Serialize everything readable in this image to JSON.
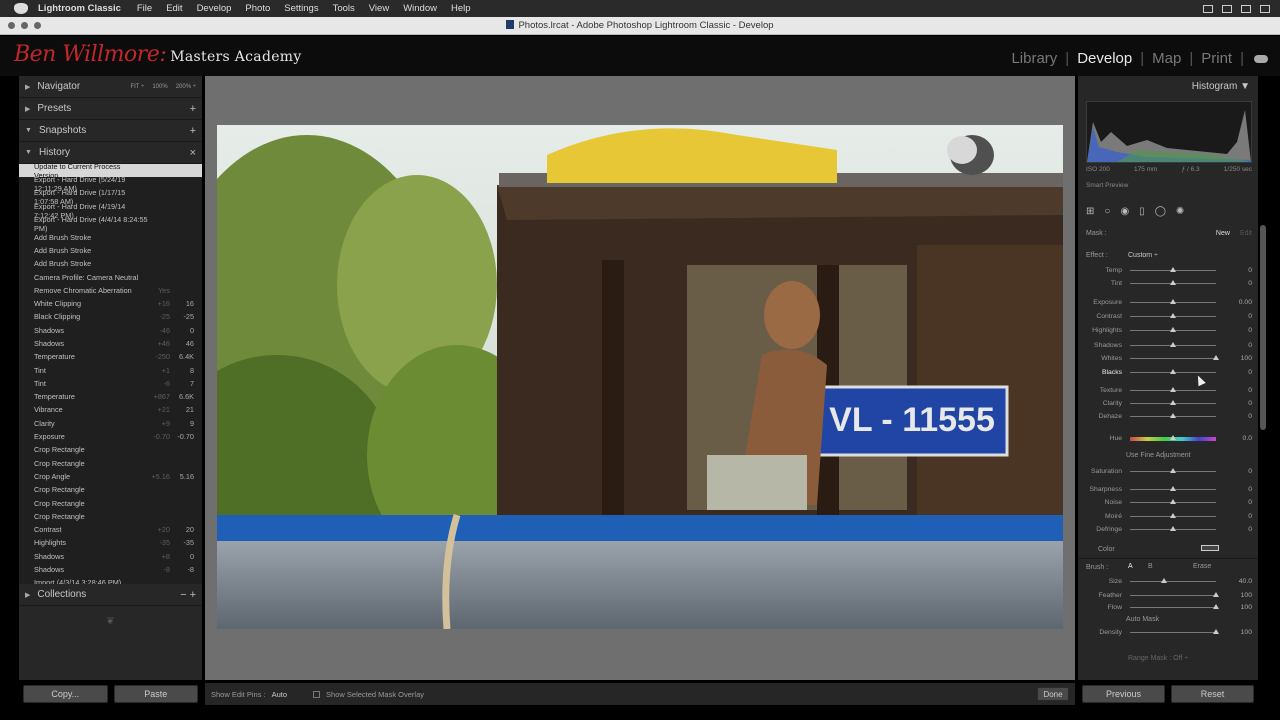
{
  "menubar": {
    "app": "Lightroom Classic",
    "items": [
      "File",
      "Edit",
      "Develop",
      "Photo",
      "Settings",
      "Tools",
      "View",
      "Window",
      "Help"
    ]
  },
  "window": {
    "title": "Photos.lrcat - Adobe Photoshop Lightroom Classic - Develop"
  },
  "brand": {
    "name": "Ben Willmore:",
    "tagline": "Masters Academy"
  },
  "modules": [
    "Library",
    "Develop",
    "Map",
    "Print"
  ],
  "left": {
    "navigator": "Navigator",
    "nav_zoom": [
      "FIT ÷",
      "100%",
      "200% ÷"
    ],
    "presets": "Presets",
    "snapshots": "Snapshots",
    "history": "History",
    "collections": "Collections",
    "history_items": [
      {
        "name": "Update to Current Process Version",
        "b": "",
        "a": ""
      },
      {
        "name": "Export - Hard Drive (5/24/19 12:11:29 AM)",
        "b": "",
        "a": ""
      },
      {
        "name": "Export - Hard Drive (1/17/15 1:07:58 AM)",
        "b": "",
        "a": ""
      },
      {
        "name": "Export - Hard Drive (4/19/14 7:12:42 PM)",
        "b": "",
        "a": ""
      },
      {
        "name": "Export - Hard Drive (4/4/14 8:24:55 PM)",
        "b": "",
        "a": ""
      },
      {
        "name": "Add Brush Stroke",
        "b": "",
        "a": ""
      },
      {
        "name": "Add Brush Stroke",
        "b": "",
        "a": ""
      },
      {
        "name": "Add Brush Stroke",
        "b": "",
        "a": ""
      },
      {
        "name": "Camera Profile: Camera Neutral",
        "b": "",
        "a": ""
      },
      {
        "name": "Remove Chromatic Aberration",
        "b": "Yes",
        "a": ""
      },
      {
        "name": "White Clipping",
        "b": "+16",
        "a": "16"
      },
      {
        "name": "Black Clipping",
        "b": "-25",
        "a": "-25"
      },
      {
        "name": "Shadows",
        "b": "-46",
        "a": "0"
      },
      {
        "name": "Shadows",
        "b": "+46",
        "a": "46"
      },
      {
        "name": "Temperature",
        "b": "-250",
        "a": "6.4K"
      },
      {
        "name": "Tint",
        "b": "+1",
        "a": "8"
      },
      {
        "name": "Tint",
        "b": "-6",
        "a": "7"
      },
      {
        "name": "Temperature",
        "b": "+867",
        "a": "6.6K"
      },
      {
        "name": "Vibrance",
        "b": "+21",
        "a": "21"
      },
      {
        "name": "Clarity",
        "b": "+9",
        "a": "9"
      },
      {
        "name": "Exposure",
        "b": "-0.70",
        "a": "-0.70"
      },
      {
        "name": "Crop Rectangle",
        "b": "",
        "a": ""
      },
      {
        "name": "Crop Rectangle",
        "b": "",
        "a": ""
      },
      {
        "name": "Crop Angle",
        "b": "+5.16",
        "a": "5.16"
      },
      {
        "name": "Crop Rectangle",
        "b": "",
        "a": ""
      },
      {
        "name": "Crop Rectangle",
        "b": "",
        "a": ""
      },
      {
        "name": "Crop Rectangle",
        "b": "",
        "a": ""
      },
      {
        "name": "Contrast",
        "b": "+20",
        "a": "20"
      },
      {
        "name": "Highlights",
        "b": "-35",
        "a": "-35"
      },
      {
        "name": "Shadows",
        "b": "+8",
        "a": "0"
      },
      {
        "name": "Shadows",
        "b": "-8",
        "a": "-8"
      },
      {
        "name": "Import (4/3/14 3:28:46 PM)",
        "b": "",
        "a": ""
      }
    ],
    "copy": "Copy...",
    "paste": "Paste"
  },
  "toolbar": {
    "show_pins_label": "Show Edit Pins :",
    "show_pins_value": "Auto",
    "overlay": "Show Selected Mask Overlay",
    "done": "Done"
  },
  "photo": {
    "plate": "VL - 11555"
  },
  "right": {
    "histogram": "Histogram",
    "exif": [
      "ISO 200",
      "175 mm",
      "ƒ / 6.3",
      "1/250 sec"
    ],
    "smart_preview": "Smart Preview",
    "mask": "Mask :",
    "new": "New",
    "edit": "Edit",
    "effect": "Effect :",
    "effect_value": "Custom ÷",
    "sliders": [
      {
        "label": "Temp",
        "val": "0",
        "pos": 0.5
      },
      {
        "label": "Tint",
        "val": "0",
        "pos": 0.5
      },
      {
        "label": "Exposure",
        "val": "0.00",
        "pos": 0.5
      },
      {
        "label": "Contrast",
        "val": "0",
        "pos": 0.5
      },
      {
        "label": "Highlights",
        "val": "0",
        "pos": 0.5
      },
      {
        "label": "Shadows",
        "val": "0",
        "pos": 0.5
      },
      {
        "label": "Whites",
        "val": "100",
        "pos": 1.0
      },
      {
        "label": "Blacks",
        "val": "0",
        "pos": 0.5
      },
      {
        "label": "Texture",
        "val": "0",
        "pos": 0.5
      },
      {
        "label": "Clarity",
        "val": "0",
        "pos": 0.5
      },
      {
        "label": "Dehaze",
        "val": "0",
        "pos": 0.5
      },
      {
        "label": "Hue",
        "val": "0.0",
        "pos": 0.5
      },
      {
        "label": "Saturation",
        "val": "0",
        "pos": 0.5
      },
      {
        "label": "Sharpness",
        "val": "0",
        "pos": 0.5
      },
      {
        "label": "Noise",
        "val": "0",
        "pos": 0.5
      },
      {
        "label": "Moiré",
        "val": "0",
        "pos": 0.5
      },
      {
        "label": "Defringe",
        "val": "0",
        "pos": 0.5
      }
    ],
    "fine_adj": "Use Fine Adjustment",
    "color": "Color",
    "brush": "Brush :",
    "brush_a": "A",
    "brush_b": "B",
    "erase": "Erase",
    "brush_sliders": [
      {
        "label": "Size",
        "val": "40.0",
        "pos": 0.4
      },
      {
        "label": "Feather",
        "val": "100",
        "pos": 1.0
      },
      {
        "label": "Flow",
        "val": "100",
        "pos": 1.0
      }
    ],
    "auto_mask": "Auto Mask",
    "density": {
      "label": "Density",
      "val": "100",
      "pos": 1.0
    },
    "range_mask": "Range Mask : Off ÷",
    "previous": "Previous",
    "reset": "Reset"
  },
  "colors": {
    "brand_red": "#c0282a",
    "panel": "#272727",
    "selected": "#d7d7d7"
  }
}
